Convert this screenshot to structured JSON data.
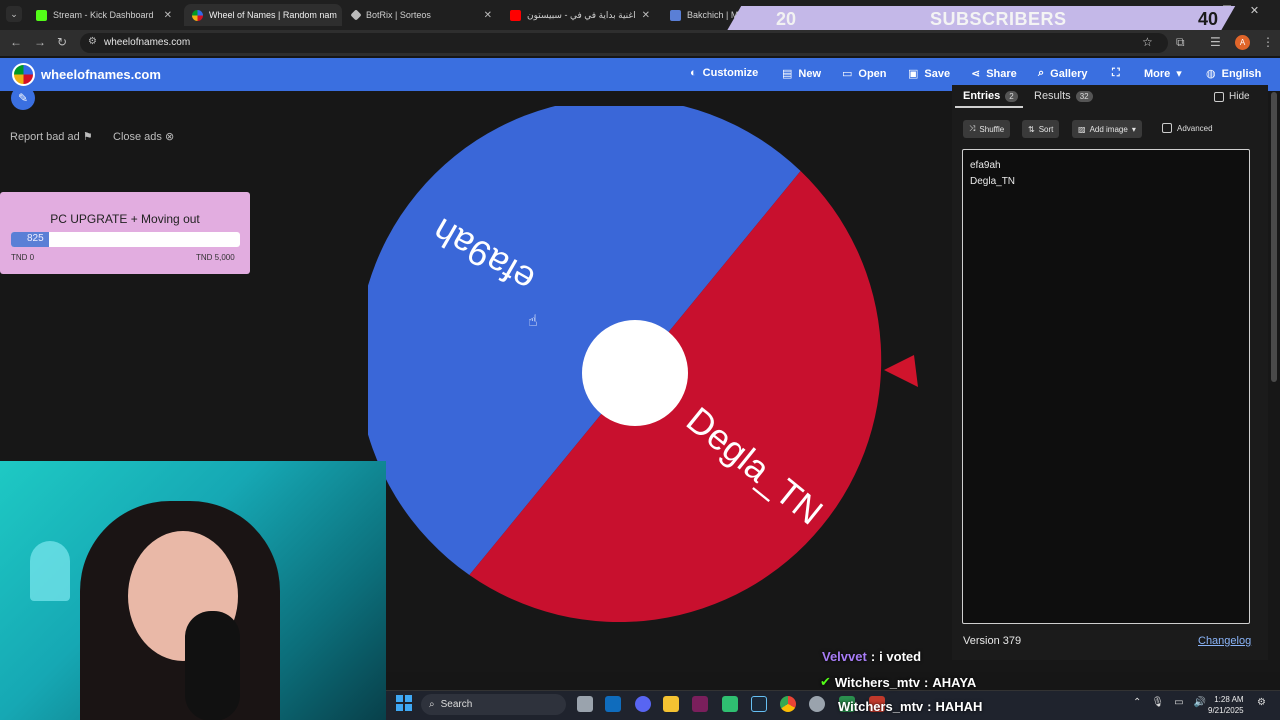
{
  "browser": {
    "tabs": [
      {
        "title": "Stream - Kick Dashboard",
        "color": "#53fc18"
      },
      {
        "title": "Wheel of Names | Random nam",
        "color": "#3369e8"
      },
      {
        "title": "BotRix | Sorteos",
        "color": "#bbbbbb"
      },
      {
        "title": "اغنية بداية في في - سبيستون",
        "color": "#ff0000"
      },
      {
        "title": "Bakchich | Monetiza",
        "color": "#5a7fd6"
      }
    ],
    "url": "wheelofnames.com",
    "profile_initial": "A"
  },
  "overlay": {
    "sub_current": "20",
    "sub_label": "SUBSCRIBERS",
    "sub_goal": "40"
  },
  "header": {
    "logo_text": "wheelofnames.com",
    "menu": [
      {
        "label": "Customize",
        "icon": "palette-icon",
        "glyph": "◐"
      },
      {
        "label": "New",
        "icon": "file-icon",
        "glyph": "▤"
      },
      {
        "label": "Open",
        "icon": "folder-icon",
        "glyph": "▭"
      },
      {
        "label": "Save",
        "icon": "save-icon",
        "glyph": "▣"
      },
      {
        "label": "Share",
        "icon": "share-icon",
        "glyph": "⋖"
      },
      {
        "label": "Gallery",
        "icon": "search-icon",
        "glyph": "⌕"
      },
      {
        "label": "",
        "icon": "fullscreen-icon",
        "glyph": "⛶"
      },
      {
        "label": "More",
        "icon": "chevron-down-icon",
        "glyph": "▾"
      },
      {
        "label": "English",
        "icon": "globe-icon",
        "glyph": "◍"
      }
    ]
  },
  "ads": {
    "report_label": "Report bad ad",
    "close_label": "Close ads"
  },
  "goal": {
    "title": "PC UPGRATE + Moving out",
    "current": "825",
    "progress": 0.165,
    "min_label": "TND 0",
    "max_label": "TND 5,000"
  },
  "wheel": {
    "segments": [
      {
        "label": "efa9ah",
        "color": "#3a67d8"
      },
      {
        "label": "Degla_TN",
        "color": "#c8102e"
      }
    ],
    "pointer_color": "#d0142c"
  },
  "panel": {
    "tab_entries": "Entries",
    "entries_count": "2",
    "tab_results": "Results",
    "results_count": "32",
    "hide_label": "Hide",
    "tools": {
      "shuffle": "Shuffle",
      "sort": "Sort",
      "add_image": "Add image",
      "advanced": "Advanced"
    },
    "entries": [
      "efa9ah",
      "Degla_TN"
    ],
    "version": "Version 379",
    "changelog": "Changelog"
  },
  "chat": [
    {
      "user": "Velvvet",
      "message": "i voted"
    },
    {
      "user": "Witchers_mtv",
      "message": "AHAYA"
    },
    {
      "user": "Witchers_mtv",
      "message": "HAHAH"
    }
  ],
  "taskbar": {
    "search_label": "Search",
    "time": "1:28 AM",
    "date": "9/21/2025"
  }
}
